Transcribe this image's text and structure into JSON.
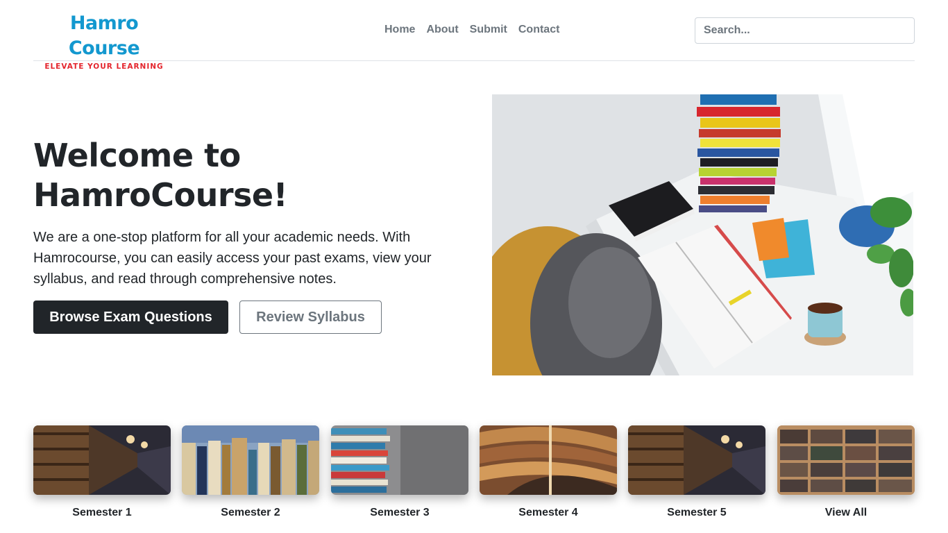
{
  "brand": {
    "title": "Hamro Course",
    "tagline": "ELEVATE YOUR LEARNING",
    "title_color": "#1398cf",
    "tagline_color": "#e4252d"
  },
  "nav": {
    "items": [
      "Home",
      "About",
      "Submit",
      "Contact"
    ]
  },
  "search": {
    "placeholder": "Search..."
  },
  "hero": {
    "title": "Welcome to HamroCourse!",
    "description": "We are a one-stop platform for all your academic needs. With Hamrocourse, you can easily access your past exams, view your syllabus, and read through comprehensive notes.",
    "primary_button": "Browse Exam Questions",
    "secondary_button": "Review Syllabus",
    "image": "desk-with-books-and-tea-photo"
  },
  "semesters": [
    {
      "label": "Semester 1",
      "image": "library-aisle-photo"
    },
    {
      "label": "Semester 2",
      "image": "books-closeup-photo"
    },
    {
      "label": "Semester 3",
      "image": "book-stack-photo"
    },
    {
      "label": "Semester 4",
      "image": "curved-library-photo"
    },
    {
      "label": "Semester 5",
      "image": "library-aisle-photo"
    },
    {
      "label": "View All",
      "image": "wooden-bookshelf-photo"
    }
  ],
  "colors": {
    "dark_button": "#212529",
    "muted": "#6c757d",
    "divider": "#dee2e6"
  }
}
